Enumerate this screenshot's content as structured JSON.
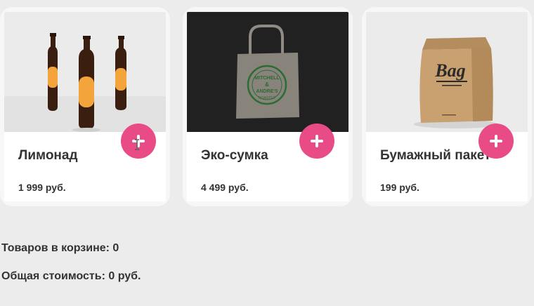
{
  "products": [
    {
      "name": "Лимонад",
      "price": "1 999 руб.",
      "image": "lemonade-bottles"
    },
    {
      "name": "Эко-сумка",
      "price": "4 499 руб.",
      "image": "eco-bag",
      "image_text": "MITCHELL & ANDRE'S COFFEE ROASTER"
    },
    {
      "name": "Бумажный пакет",
      "price": "199 руб.",
      "image": "paper-bag",
      "image_text": "Bag"
    }
  ],
  "cart": {
    "count_text": "Товаров в корзине: 0",
    "total_text": "Общая стоимость: 0 руб."
  },
  "colors": {
    "accent": "#e94b86",
    "page_bg": "#ececec",
    "card_bg": "#ffffff",
    "text": "#333333"
  }
}
